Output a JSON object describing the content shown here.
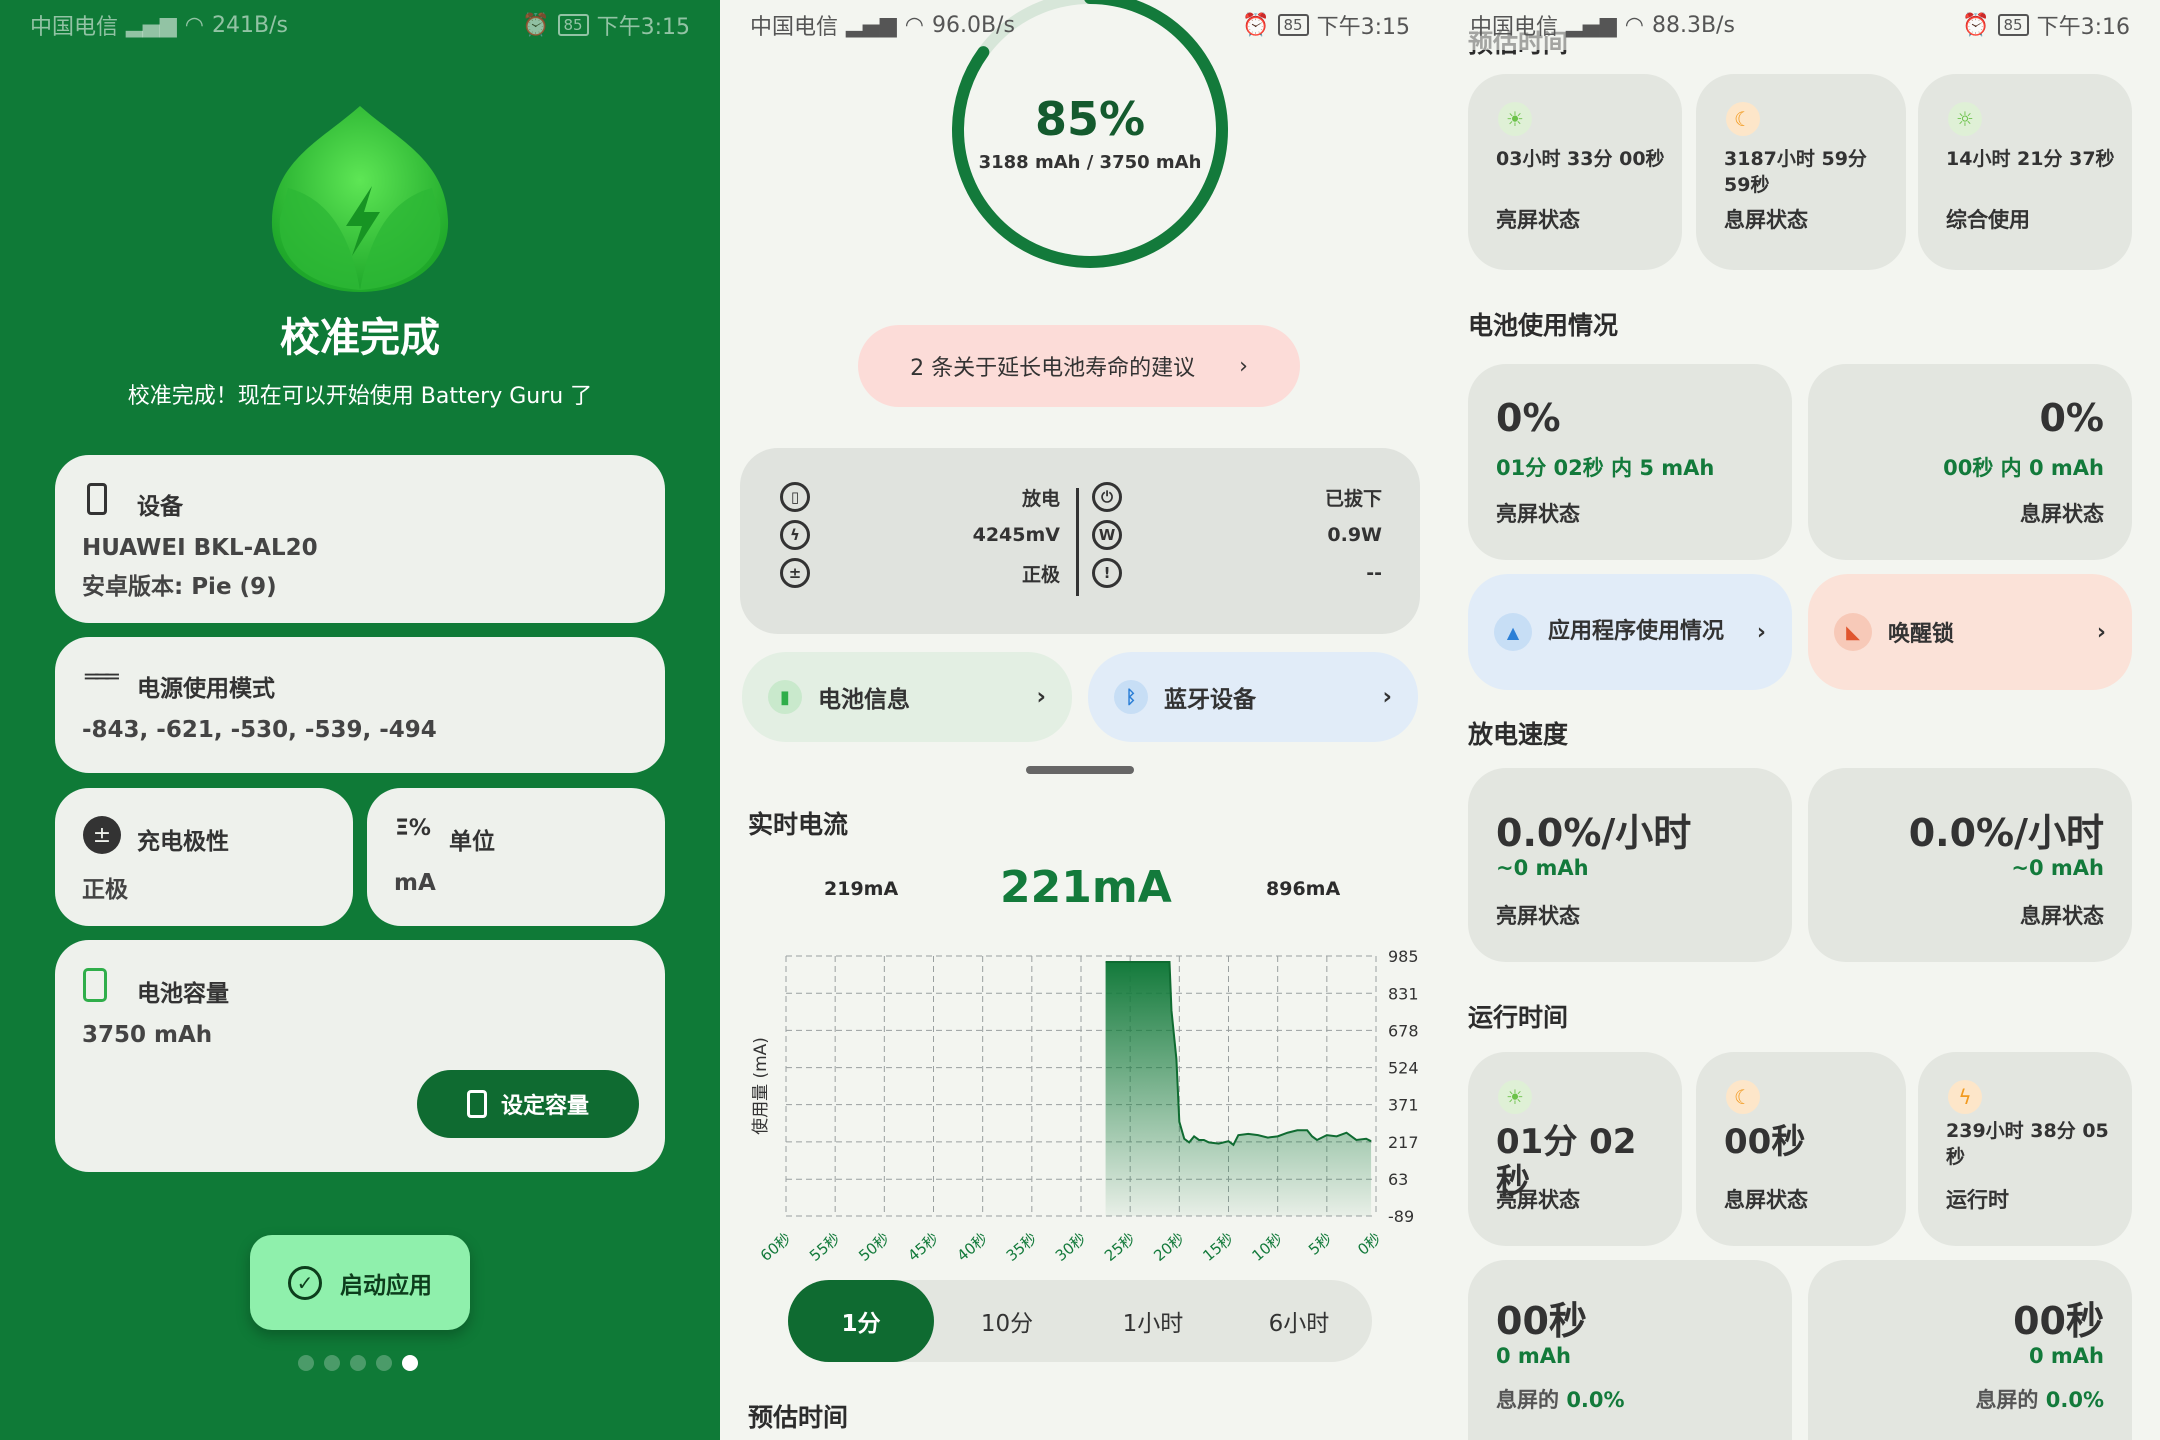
{
  "p1": {
    "status": {
      "carrier": "中国电信",
      "speed": "241B/s",
      "battery": "85",
      "time": "下午3:15"
    },
    "title": "校准完成",
    "subtitle": "校准完成！现在可以开始使用 Battery Guru 了",
    "device": {
      "label": "设备",
      "model": "HUAWEI BKL-AL20",
      "android": "安卓版本: Pie (9)"
    },
    "power_mode": {
      "label": "电源使用模式",
      "values": "-843, -621, -530, -539, -494"
    },
    "polarity": {
      "label": "充电极性",
      "value": "正极"
    },
    "unit": {
      "label": "单位",
      "value": "mA"
    },
    "capacity": {
      "label": "电池容量",
      "value": "3750 mAh",
      "button": "设定容量"
    },
    "start_button": "启动应用",
    "page_dots": 5,
    "active_dot": 4
  },
  "p2": {
    "status": {
      "carrier": "中国电信",
      "speed": "96.0B/s",
      "battery": "85",
      "time": "下午3:15"
    },
    "percent": "85%",
    "mah": "3188 mAh / 3750 mAh",
    "ring_level": 0.85,
    "advice": "2 条关于延长电池寿命的建议",
    "stats": {
      "left": [
        {
          "label": "放电",
          "icon": "battery-plus-icon"
        },
        {
          "label": "4245mV",
          "icon": "bolt-icon"
        },
        {
          "label": "正极",
          "icon": "polarity-icon"
        }
      ],
      "right": [
        {
          "label": "已拔下",
          "icon": "plug-icon"
        },
        {
          "label": "0.9W",
          "icon": "watt-icon"
        },
        {
          "label": "--",
          "icon": "alert-icon"
        }
      ]
    },
    "battery_info": "电池信息",
    "bluetooth": "蓝牙设备",
    "realtime": {
      "title": "实时电流",
      "min": "219mA",
      "current": "221mA",
      "max": "896mA",
      "ylabel": "使用量 (mA)"
    },
    "tabs": [
      "1分",
      "10分",
      "1小时",
      "6小时"
    ],
    "active_tab": 0,
    "footer_title": "预估时间"
  },
  "chart_data": {
    "type": "area",
    "title": "实时电流",
    "ylabel": "使用量 (mA)",
    "x": [
      "60秒",
      "55秒",
      "50秒",
      "45秒",
      "40秒",
      "35秒",
      "30秒",
      "25秒",
      "20秒",
      "15秒",
      "10秒",
      "5秒",
      "0秒"
    ],
    "ylim": [
      -89,
      985
    ],
    "yticks": [
      985,
      831,
      678,
      524,
      371,
      217,
      63,
      -89
    ],
    "series": [
      {
        "x_sec": [
          27.5,
          27,
          26,
          25,
          24,
          23,
          22,
          21,
          20.8,
          20.3,
          20,
          19.5,
          19,
          18.5,
          18,
          17.5,
          17,
          16,
          15,
          14.5,
          14,
          13,
          12,
          11,
          10,
          9,
          8,
          7,
          6.5,
          6,
          5,
          4,
          3,
          2,
          1,
          0.5
        ],
        "values": [
          960,
          960,
          960,
          960,
          960,
          960,
          960,
          960,
          760,
          560,
          300,
          230,
          215,
          240,
          225,
          225,
          215,
          210,
          220,
          205,
          245,
          250,
          245,
          235,
          240,
          255,
          265,
          265,
          240,
          225,
          245,
          240,
          255,
          225,
          230,
          220
        ]
      }
    ]
  },
  "p3": {
    "status": {
      "carrier": "中国电信",
      "speed": "88.3B/s",
      "battery": "85",
      "time": "下午3:16"
    },
    "top_title": "预估时间",
    "estimates": [
      {
        "value": "03小时 33分 00秒",
        "label": "亮屏状态",
        "icon": "sun-icon"
      },
      {
        "value": "3187小时 59分 59秒",
        "label": "息屏状态",
        "icon": "moon-icon"
      },
      {
        "value": "14小时 21分 37秒",
        "label": "综合使用",
        "icon": "sun-moon-icon"
      }
    ],
    "usage_title": "电池使用情况",
    "usage": [
      {
        "pct": "0%",
        "detail": "01分 02秒 内 5 mAh",
        "label": "亮屏状态"
      },
      {
        "pct": "0%",
        "detail": "00秒 内 0 mAh",
        "label": "息屏状态"
      }
    ],
    "app_usage": "应用程序使用情况",
    "wakelock": "唤醒锁",
    "speed_title": "放电速度",
    "speed": [
      {
        "rate": "0.0%/小时",
        "mah": "~0 mAh",
        "label": "亮屏状态"
      },
      {
        "rate": "0.0%/小时",
        "mah": "~0 mAh",
        "label": "息屏状态"
      }
    ],
    "runtime_title": "运行时间",
    "runtime": [
      {
        "value": "01分 02秒",
        "label": "亮屏状态",
        "icon": "sun-icon"
      },
      {
        "value": "00秒",
        "label": "息屏状态",
        "icon": "moon-icon"
      },
      {
        "value": "239小时 38分 05秒",
        "label": "运行时",
        "icon": "bolt-icon"
      }
    ],
    "bottom": [
      {
        "value": "00秒",
        "mah": "0 mAh",
        "label": "息屏的",
        "pct": "0.0%"
      },
      {
        "value": "00秒",
        "mah": "0 mAh",
        "label": "息屏的",
        "pct": "0.0%"
      }
    ]
  },
  "colors": {
    "primary_green": "#0f7a37",
    "accent_green": "#137a3b",
    "advice_pink": "#fcdcd8",
    "blue_card": "#e1ecf8",
    "orange_card": "#fbe2d8",
    "mint_button": "#8ff0ac"
  }
}
